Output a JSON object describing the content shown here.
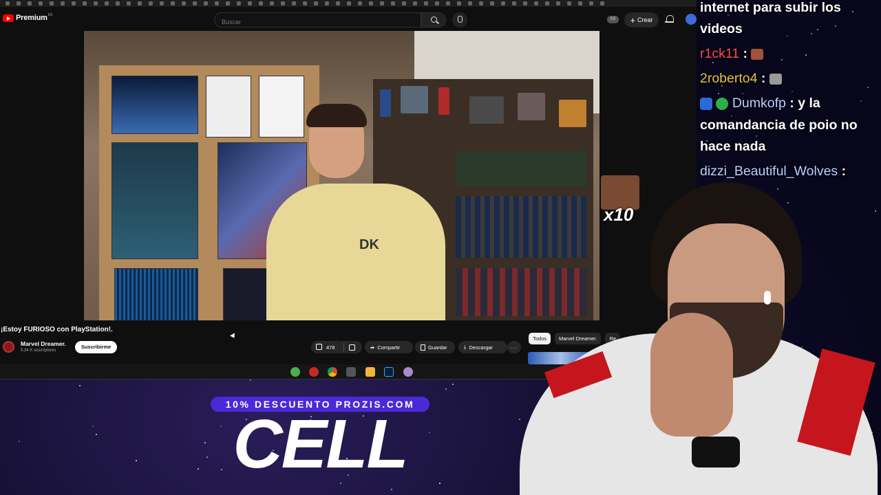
{
  "youtube": {
    "brand": "Premium",
    "brand_region": "ES",
    "search_placeholder": "Buscar",
    "cast_label": "SS",
    "create_label": "Crear",
    "video": {
      "title": "¡Estoy FURIOSO con PlayStation!.",
      "channel_name": "Marvel Dreamer.",
      "subscribers": "5,34 K suscriptores",
      "subscribe_label": "Suscribirme",
      "likes": "478",
      "share_label": "Compartir",
      "save_label": "Guardar",
      "download_label": "Descargar",
      "more_label": "···",
      "shirt_logo": "DK"
    },
    "chips": [
      "Todos",
      "Marvel Dreamer.",
      "Re"
    ]
  },
  "chat": {
    "lines": [
      {
        "user": "",
        "text": "internet para subir los"
      },
      {
        "user": "",
        "text": "videos"
      },
      {
        "user": "r1ck11",
        "text": ":",
        "color": "#ff4a4a"
      },
      {
        "user": "2roberto4",
        "text": ":",
        "color": "#e6c23a"
      },
      {
        "user": "Dumkofp",
        "text": ": y la",
        "color": "#b9d0ff"
      },
      {
        "user": "",
        "text": "comandancia de poio no"
      },
      {
        "user": "",
        "text": "hace nada"
      },
      {
        "user": "dizzi_Beautiful_Wolves",
        "text": ":",
        "color": "#b9d0ff"
      }
    ]
  },
  "emote": {
    "multiplier": "x10"
  },
  "sponsor": {
    "tag": "10% DESCUENTO PROZIS.COM",
    "code": "CELL"
  },
  "colors": {
    "accent": "#ff0000",
    "sponsor": "#4a2ad8",
    "stripe": "#c4161c"
  }
}
